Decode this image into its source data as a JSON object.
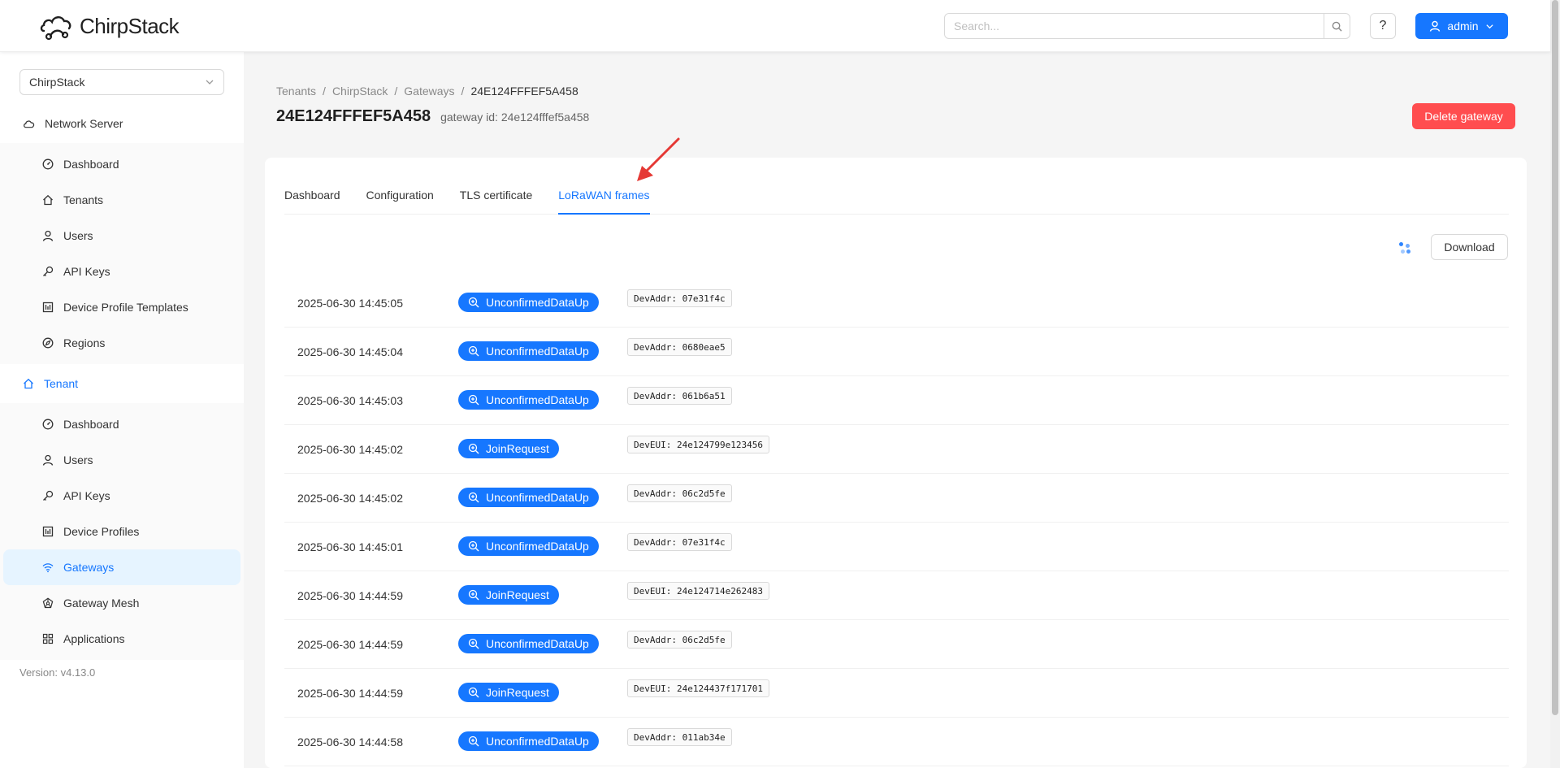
{
  "header": {
    "brand": "ChirpStack",
    "search_placeholder": "Search...",
    "help_label": "?",
    "user_label": "admin"
  },
  "sidebar": {
    "tenant_select_value": "ChirpStack",
    "network_server_label": "Network Server",
    "network_server_items": [
      {
        "label": "Dashboard",
        "icon": "dashboard-icon"
      },
      {
        "label": "Tenants",
        "icon": "home-icon"
      },
      {
        "label": "Users",
        "icon": "user-icon"
      },
      {
        "label": "API Keys",
        "icon": "key-icon"
      },
      {
        "label": "Device Profile Templates",
        "icon": "template-icon"
      },
      {
        "label": "Regions",
        "icon": "compass-icon"
      }
    ],
    "tenant_label": "Tenant",
    "tenant_items": [
      {
        "label": "Dashboard",
        "icon": "dashboard-icon"
      },
      {
        "label": "Users",
        "icon": "user-icon"
      },
      {
        "label": "API Keys",
        "icon": "key-icon"
      },
      {
        "label": "Device Profiles",
        "icon": "template-icon"
      },
      {
        "label": "Gateways",
        "icon": "wifi-icon",
        "selected": true
      },
      {
        "label": "Gateway Mesh",
        "icon": "mesh-icon"
      },
      {
        "label": "Applications",
        "icon": "apps-icon"
      }
    ],
    "version": "Version: v4.13.0"
  },
  "breadcrumb": [
    "Tenants",
    "ChirpStack",
    "Gateways",
    "24E124FFFEF5A458"
  ],
  "page": {
    "title": "24E124FFFEF5A458",
    "subtitle": "gateway id: 24e124fffef5a458",
    "delete_label": "Delete gateway"
  },
  "tabs": [
    {
      "label": "Dashboard"
    },
    {
      "label": "Configuration"
    },
    {
      "label": "TLS certificate"
    },
    {
      "label": "LoRaWAN frames",
      "active": true
    }
  ],
  "download_label": "Download",
  "frames": [
    {
      "time": "2025-06-30 14:45:05",
      "type": "UnconfirmedDataUp",
      "detail": "DevAddr: 07e31f4c"
    },
    {
      "time": "2025-06-30 14:45:04",
      "type": "UnconfirmedDataUp",
      "detail": "DevAddr: 0680eae5"
    },
    {
      "time": "2025-06-30 14:45:03",
      "type": "UnconfirmedDataUp",
      "detail": "DevAddr: 061b6a51"
    },
    {
      "time": "2025-06-30 14:45:02",
      "type": "JoinRequest",
      "detail": "DevEUI: 24e124799e123456"
    },
    {
      "time": "2025-06-30 14:45:02",
      "type": "UnconfirmedDataUp",
      "detail": "DevAddr: 06c2d5fe"
    },
    {
      "time": "2025-06-30 14:45:01",
      "type": "UnconfirmedDataUp",
      "detail": "DevAddr: 07e31f4c"
    },
    {
      "time": "2025-06-30 14:44:59",
      "type": "JoinRequest",
      "detail": "DevEUI: 24e124714e262483"
    },
    {
      "time": "2025-06-30 14:44:59",
      "type": "UnconfirmedDataUp",
      "detail": "DevAddr: 06c2d5fe"
    },
    {
      "time": "2025-06-30 14:44:59",
      "type": "JoinRequest",
      "detail": "DevEUI: 24e124437f171701"
    },
    {
      "time": "2025-06-30 14:44:58",
      "type": "UnconfirmedDataUp",
      "detail": "DevAddr: 011ab34e"
    }
  ],
  "colors": {
    "primary": "#1677ff",
    "danger": "#ff4d4f",
    "annotation_arrow": "#e53935"
  }
}
